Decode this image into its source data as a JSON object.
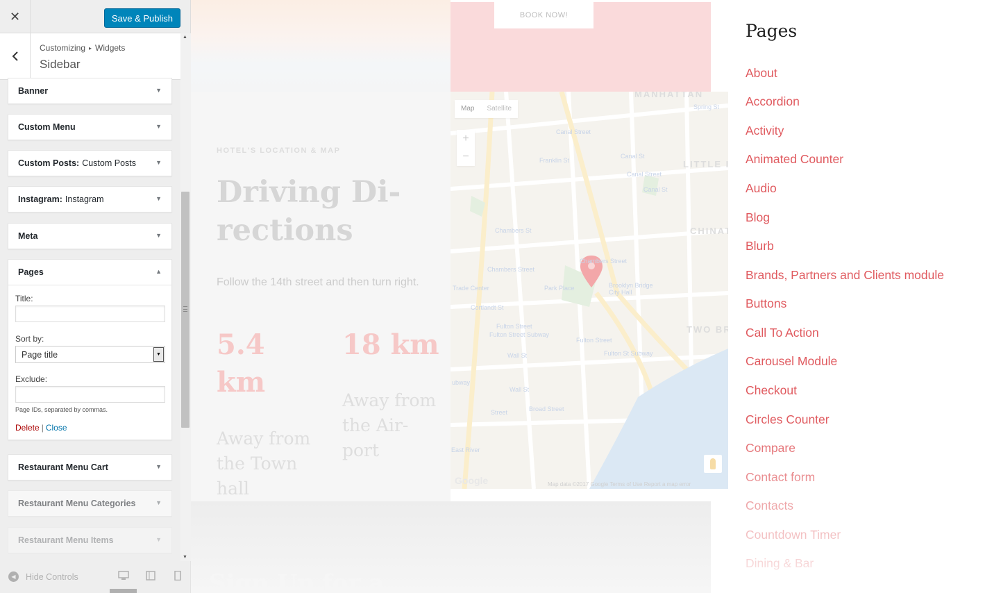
{
  "customizer": {
    "close_icon": "close-icon",
    "publish_label": "Save & Publish",
    "breadcrumb": {
      "root": "Customizing",
      "sep": "▸",
      "current": "Widgets"
    },
    "section_title": "Sidebar",
    "widgets": [
      {
        "title": "Banner",
        "sub": ""
      },
      {
        "title": "Custom Menu",
        "sub": ""
      },
      {
        "title": "Custom Posts:",
        "sub": "Custom Posts"
      },
      {
        "title": "Instagram:",
        "sub": "Instagram"
      },
      {
        "title": "Meta",
        "sub": ""
      },
      {
        "title": "Pages",
        "sub": ""
      },
      {
        "title": "Restaurant Menu Cart",
        "sub": ""
      },
      {
        "title": "Restaurant Menu Categories",
        "sub": ""
      },
      {
        "title": "Restaurant Menu Items",
        "sub": ""
      }
    ],
    "pages_form": {
      "title_label": "Title:",
      "title_value": "",
      "sort_label": "Sort by:",
      "sort_value": "Page title",
      "exclude_label": "Exclude:",
      "exclude_value": "",
      "exclude_hint": "Page IDs, separated by commas.",
      "delete_label": "Delete",
      "action_sep": "|",
      "close_label": "Close"
    },
    "footer": {
      "hide_label": "Hide Controls"
    }
  },
  "preview": {
    "book_label": "BOOK NOW!",
    "eyebrow": "HOTEL'S LOCATION & MAP",
    "title": "Driving Di- rections",
    "text": "Follow the 14th street and then turn right.",
    "stats": [
      {
        "value": "5.4 km",
        "label": "Away from the Town hall"
      },
      {
        "value": "18 km",
        "label": "Away from the Air- port"
      }
    ],
    "map": {
      "tab_map": "Map",
      "tab_satellite": "Satellite",
      "zoom_in": "+",
      "zoom_out": "−",
      "areas": [
        "MANHATTAN",
        "LITTLE I",
        "CHINAT",
        "TWO BR"
      ],
      "streets": [
        "Spring St",
        "Canal Street",
        "Canal St",
        "Franklin St",
        "Canal Street",
        "Canal St",
        "Chambers St",
        "Chambers Street",
        "Chambers Street",
        "Park Place",
        "Trade Center",
        "Brooklyn Bridge City Hall",
        "Cortlandt St",
        "Fulton Street",
        "Fulton Street Subway",
        "Fulton Street",
        "Fulton St Subway",
        "Wall St",
        "Wall St",
        "Broad Street",
        "Street",
        "ubway",
        "East River"
      ],
      "footer": "Map data ©2017 Google   Terms of Use   Report a map error",
      "google": "Google"
    },
    "signup": "Sign Up for a"
  },
  "pages_widget": {
    "title": "Pages",
    "link_color": "#e05a5f",
    "links": [
      "About",
      "Accordion",
      "Activity",
      "Animated Counter",
      "Audio",
      "Blog",
      "Blurb",
      "Brands, Partners and Clients module",
      "Buttons",
      "Call To Action",
      "Carousel Module",
      "Checkout",
      "Circles Counter",
      "Compare",
      "Contact form",
      "Contacts",
      "Countdown Timer",
      "Dining & Bar"
    ]
  },
  "colors": {
    "publish": "#0085ba",
    "accent_pink": "#e05a5f",
    "delete": "#aa0000",
    "link_blue": "#0073aa"
  }
}
